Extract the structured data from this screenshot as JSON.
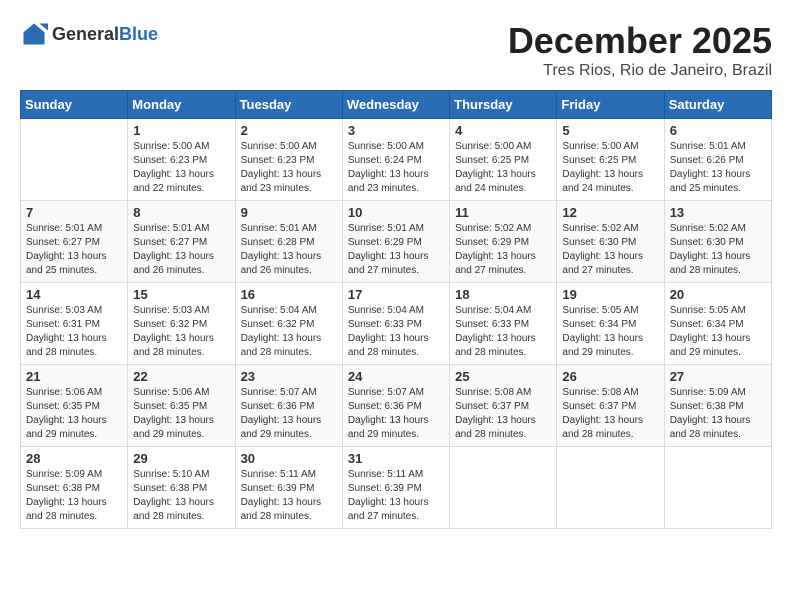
{
  "logo": {
    "general": "General",
    "blue": "Blue"
  },
  "title": "December 2025",
  "location": "Tres Rios, Rio de Janeiro, Brazil",
  "weekdays": [
    "Sunday",
    "Monday",
    "Tuesday",
    "Wednesday",
    "Thursday",
    "Friday",
    "Saturday"
  ],
  "weeks": [
    [
      {
        "day": "",
        "sunrise": "",
        "sunset": "",
        "daylight": ""
      },
      {
        "day": "1",
        "sunrise": "Sunrise: 5:00 AM",
        "sunset": "Sunset: 6:23 PM",
        "daylight": "Daylight: 13 hours and 22 minutes."
      },
      {
        "day": "2",
        "sunrise": "Sunrise: 5:00 AM",
        "sunset": "Sunset: 6:23 PM",
        "daylight": "Daylight: 13 hours and 23 minutes."
      },
      {
        "day": "3",
        "sunrise": "Sunrise: 5:00 AM",
        "sunset": "Sunset: 6:24 PM",
        "daylight": "Daylight: 13 hours and 23 minutes."
      },
      {
        "day": "4",
        "sunrise": "Sunrise: 5:00 AM",
        "sunset": "Sunset: 6:25 PM",
        "daylight": "Daylight: 13 hours and 24 minutes."
      },
      {
        "day": "5",
        "sunrise": "Sunrise: 5:00 AM",
        "sunset": "Sunset: 6:25 PM",
        "daylight": "Daylight: 13 hours and 24 minutes."
      },
      {
        "day": "6",
        "sunrise": "Sunrise: 5:01 AM",
        "sunset": "Sunset: 6:26 PM",
        "daylight": "Daylight: 13 hours and 25 minutes."
      }
    ],
    [
      {
        "day": "7",
        "sunrise": "Sunrise: 5:01 AM",
        "sunset": "Sunset: 6:27 PM",
        "daylight": "Daylight: 13 hours and 25 minutes."
      },
      {
        "day": "8",
        "sunrise": "Sunrise: 5:01 AM",
        "sunset": "Sunset: 6:27 PM",
        "daylight": "Daylight: 13 hours and 26 minutes."
      },
      {
        "day": "9",
        "sunrise": "Sunrise: 5:01 AM",
        "sunset": "Sunset: 6:28 PM",
        "daylight": "Daylight: 13 hours and 26 minutes."
      },
      {
        "day": "10",
        "sunrise": "Sunrise: 5:01 AM",
        "sunset": "Sunset: 6:29 PM",
        "daylight": "Daylight: 13 hours and 27 minutes."
      },
      {
        "day": "11",
        "sunrise": "Sunrise: 5:02 AM",
        "sunset": "Sunset: 6:29 PM",
        "daylight": "Daylight: 13 hours and 27 minutes."
      },
      {
        "day": "12",
        "sunrise": "Sunrise: 5:02 AM",
        "sunset": "Sunset: 6:30 PM",
        "daylight": "Daylight: 13 hours and 27 minutes."
      },
      {
        "day": "13",
        "sunrise": "Sunrise: 5:02 AM",
        "sunset": "Sunset: 6:30 PM",
        "daylight": "Daylight: 13 hours and 28 minutes."
      }
    ],
    [
      {
        "day": "14",
        "sunrise": "Sunrise: 5:03 AM",
        "sunset": "Sunset: 6:31 PM",
        "daylight": "Daylight: 13 hours and 28 minutes."
      },
      {
        "day": "15",
        "sunrise": "Sunrise: 5:03 AM",
        "sunset": "Sunset: 6:32 PM",
        "daylight": "Daylight: 13 hours and 28 minutes."
      },
      {
        "day": "16",
        "sunrise": "Sunrise: 5:04 AM",
        "sunset": "Sunset: 6:32 PM",
        "daylight": "Daylight: 13 hours and 28 minutes."
      },
      {
        "day": "17",
        "sunrise": "Sunrise: 5:04 AM",
        "sunset": "Sunset: 6:33 PM",
        "daylight": "Daylight: 13 hours and 28 minutes."
      },
      {
        "day": "18",
        "sunrise": "Sunrise: 5:04 AM",
        "sunset": "Sunset: 6:33 PM",
        "daylight": "Daylight: 13 hours and 28 minutes."
      },
      {
        "day": "19",
        "sunrise": "Sunrise: 5:05 AM",
        "sunset": "Sunset: 6:34 PM",
        "daylight": "Daylight: 13 hours and 29 minutes."
      },
      {
        "day": "20",
        "sunrise": "Sunrise: 5:05 AM",
        "sunset": "Sunset: 6:34 PM",
        "daylight": "Daylight: 13 hours and 29 minutes."
      }
    ],
    [
      {
        "day": "21",
        "sunrise": "Sunrise: 5:06 AM",
        "sunset": "Sunset: 6:35 PM",
        "daylight": "Daylight: 13 hours and 29 minutes."
      },
      {
        "day": "22",
        "sunrise": "Sunrise: 5:06 AM",
        "sunset": "Sunset: 6:35 PM",
        "daylight": "Daylight: 13 hours and 29 minutes."
      },
      {
        "day": "23",
        "sunrise": "Sunrise: 5:07 AM",
        "sunset": "Sunset: 6:36 PM",
        "daylight": "Daylight: 13 hours and 29 minutes."
      },
      {
        "day": "24",
        "sunrise": "Sunrise: 5:07 AM",
        "sunset": "Sunset: 6:36 PM",
        "daylight": "Daylight: 13 hours and 29 minutes."
      },
      {
        "day": "25",
        "sunrise": "Sunrise: 5:08 AM",
        "sunset": "Sunset: 6:37 PM",
        "daylight": "Daylight: 13 hours and 28 minutes."
      },
      {
        "day": "26",
        "sunrise": "Sunrise: 5:08 AM",
        "sunset": "Sunset: 6:37 PM",
        "daylight": "Daylight: 13 hours and 28 minutes."
      },
      {
        "day": "27",
        "sunrise": "Sunrise: 5:09 AM",
        "sunset": "Sunset: 6:38 PM",
        "daylight": "Daylight: 13 hours and 28 minutes."
      }
    ],
    [
      {
        "day": "28",
        "sunrise": "Sunrise: 5:09 AM",
        "sunset": "Sunset: 6:38 PM",
        "daylight": "Daylight: 13 hours and 28 minutes."
      },
      {
        "day": "29",
        "sunrise": "Sunrise: 5:10 AM",
        "sunset": "Sunset: 6:38 PM",
        "daylight": "Daylight: 13 hours and 28 minutes."
      },
      {
        "day": "30",
        "sunrise": "Sunrise: 5:11 AM",
        "sunset": "Sunset: 6:39 PM",
        "daylight": "Daylight: 13 hours and 28 minutes."
      },
      {
        "day": "31",
        "sunrise": "Sunrise: 5:11 AM",
        "sunset": "Sunset: 6:39 PM",
        "daylight": "Daylight: 13 hours and 27 minutes."
      },
      {
        "day": "",
        "sunrise": "",
        "sunset": "",
        "daylight": ""
      },
      {
        "day": "",
        "sunrise": "",
        "sunset": "",
        "daylight": ""
      },
      {
        "day": "",
        "sunrise": "",
        "sunset": "",
        "daylight": ""
      }
    ]
  ]
}
